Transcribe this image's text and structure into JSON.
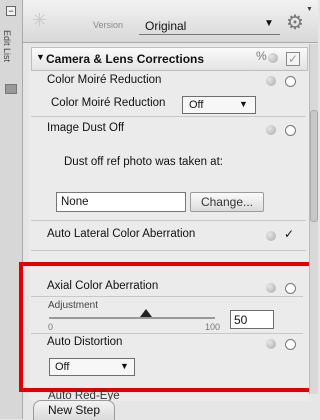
{
  "sidebar": {
    "tab_label": "Edit List"
  },
  "toolbar": {
    "version_label": "Version",
    "version_value": "Original",
    "version_arrow": "▼",
    "gear_glyph": "⚙",
    "gear_arrow": "▼"
  },
  "section": {
    "title": "Camera & Lens Corrections",
    "collapse_glyph": "▼",
    "link_glyph": "%",
    "check_glyph": "✓"
  },
  "rows": {
    "color_moire_header": "Color Moiré Reduction",
    "color_moire_label": "Color Moiré Reduction",
    "color_moire_value": "Off",
    "image_dust_header": "Image Dust Off",
    "dust_prompt": "Dust off ref photo was taken at:",
    "dust_value": "None",
    "change_button": "Change...",
    "auto_lateral_header": "Auto Lateral Color Aberration",
    "auto_lateral_check": "✓",
    "axial_header": "Axial Color Aberration",
    "adjustment_label": "Adjustment",
    "slider_min": "0",
    "slider_max": "100",
    "adjustment_value": "50",
    "auto_distortion_header": "Auto Distortion",
    "auto_distortion_value": "Off",
    "cutoff_next": "Auto Red-Eye"
  },
  "footer": {
    "new_step": "New Step"
  },
  "colors": {
    "highlight": "#e00000"
  }
}
